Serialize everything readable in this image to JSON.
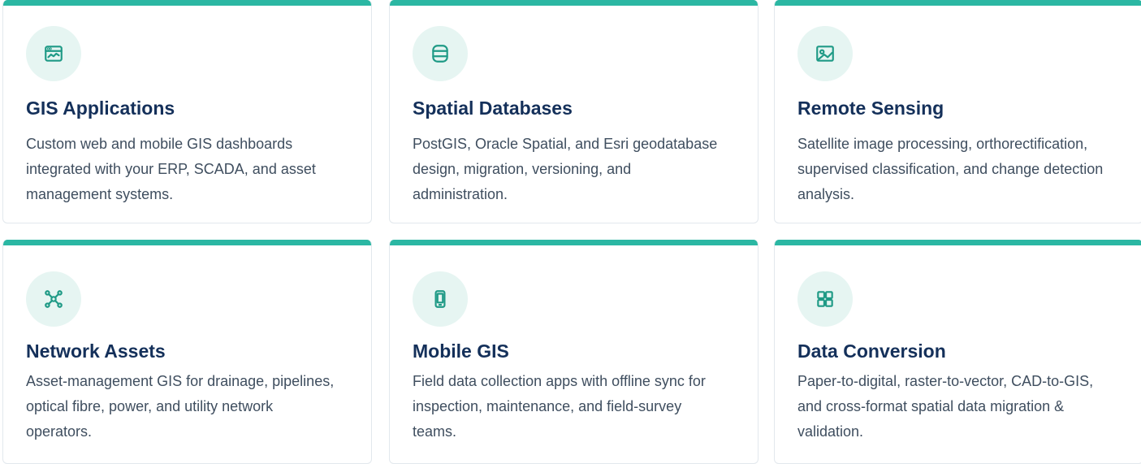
{
  "colors": {
    "accent": "#2bb7a3",
    "icon": "#1f9a86",
    "icon_bg": "#e6f5f2",
    "title": "#14305a",
    "text": "#3f4e5f"
  },
  "services": [
    {
      "icon": "browser-chart-icon",
      "title": "GIS Applications",
      "description": "Custom web and mobile GIS dashboards integrated with your ERP, SCADA, and asset management systems."
    },
    {
      "icon": "database-icon",
      "title": "Spatial Databases",
      "description": "PostGIS, Oracle Spatial, and Esri geodatabase design, migration, versioning, and administration."
    },
    {
      "icon": "image-icon",
      "title": "Remote Sensing",
      "description": "Satellite image processing, orthorectification, supervised classification, and change detection analysis."
    },
    {
      "icon": "network-icon",
      "title": "Network Assets",
      "description": "Asset-management GIS for drainage, pipelines, optical fibre, power, and utility network operators."
    },
    {
      "icon": "mobile-icon",
      "title": "Mobile GIS",
      "description": "Field data collection apps with offline sync for inspection, maintenance, and field-survey teams."
    },
    {
      "icon": "grid-icon",
      "title": "Data Conversion",
      "description": "Paper-to-digital, raster-to-vector, CAD-to-GIS, and cross-format spatial data migration & validation."
    }
  ]
}
